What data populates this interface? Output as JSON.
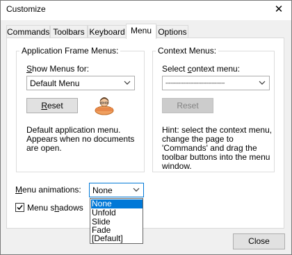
{
  "window": {
    "title": "Customize",
    "close_glyph": "✕"
  },
  "tabs": [
    {
      "label": "Commands",
      "active": false
    },
    {
      "label": "Toolbars",
      "active": false
    },
    {
      "label": "Keyboard",
      "active": false
    },
    {
      "label": "Menu",
      "active": true
    },
    {
      "label": "Options",
      "active": false
    }
  ],
  "app_frame": {
    "group_label": "Application Frame Menus:",
    "show_label": "Show Menus for:",
    "combo_value": "Default Menu",
    "reset_label": "Reset",
    "description": "Default application menu. Appears when no documents are open."
  },
  "context": {
    "group_label": "Context Menus:",
    "select_label": "Select context menu:",
    "combo_value": "------------------------------------",
    "reset_label": "Reset",
    "hint": "Hint: select the context menu, change the page to 'Commands' and drag the toolbar buttons into the menu window."
  },
  "animations": {
    "label": "Menu animations:",
    "value": "None",
    "options": [
      "None",
      "Unfold",
      "Slide",
      "Fade",
      "[Default]"
    ]
  },
  "shadows": {
    "label": "Menu shadows",
    "checked": true
  },
  "close_button": "Close",
  "colors": {
    "selection": "#0078d7",
    "window_bg": "#f0f0f0"
  },
  "icons": [
    "close-icon",
    "chevron-down-icon",
    "menu-person-icon",
    "checkmark-icon"
  ]
}
